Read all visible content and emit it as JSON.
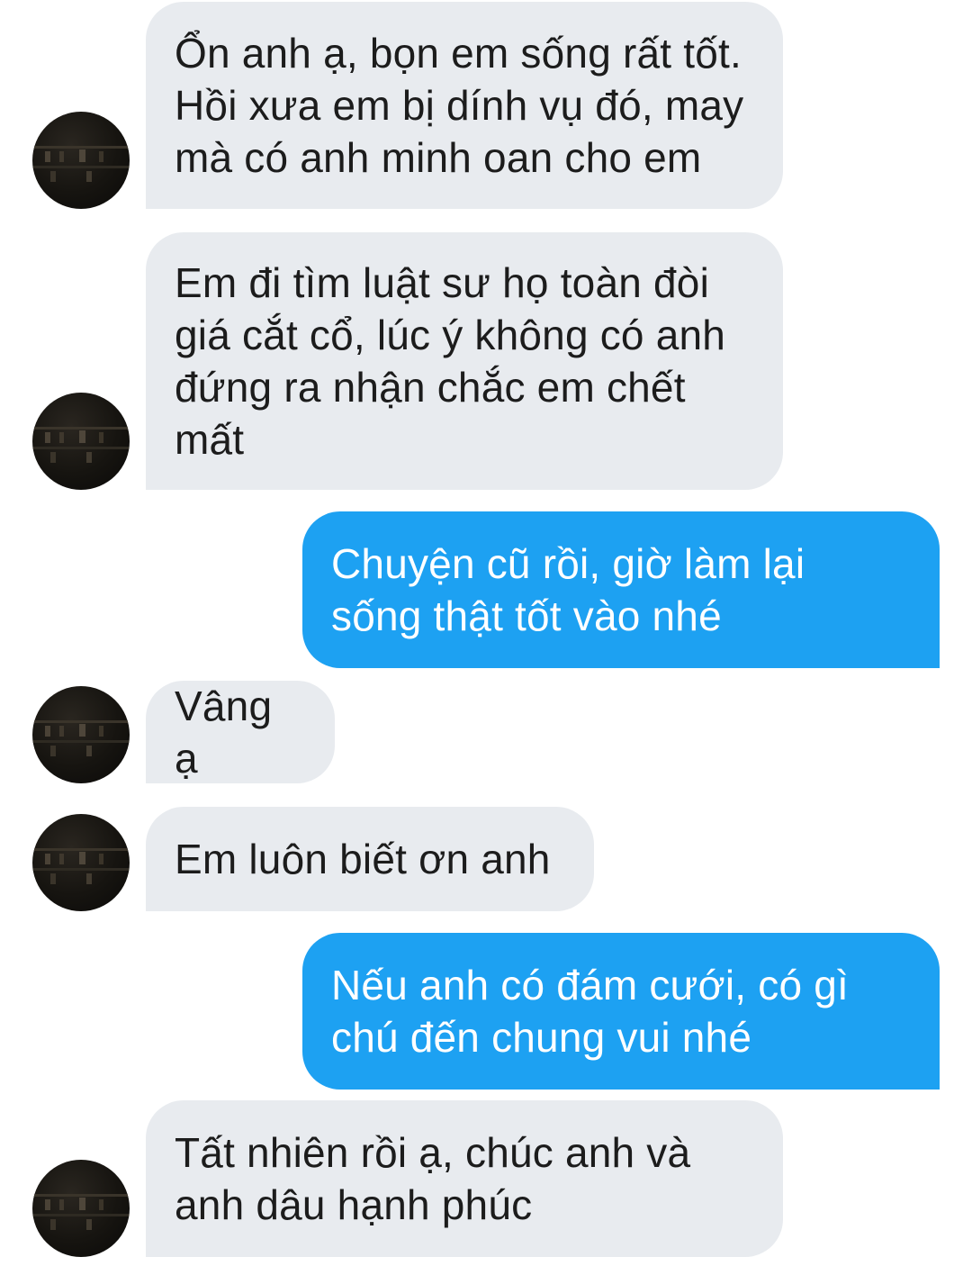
{
  "conversation": {
    "messages": [
      {
        "sender": "contact",
        "text": "Ổn anh ạ, bọn em sống rất tốt.\nHồi xưa em bị dính vụ đó, may\nmà có anh minh oan cho em"
      },
      {
        "sender": "contact",
        "text": "Em đi tìm luật sư họ toàn đòi\ngiá cắt cổ, lúc ý không có anh\nđứng ra nhận chắc em chết\nmất"
      },
      {
        "sender": "me",
        "text": "Chuyện cũ rồi, giờ làm lại\nsống thật tốt vào nhé"
      },
      {
        "sender": "contact",
        "text": "Vâng ạ"
      },
      {
        "sender": "contact",
        "text": "Em luôn biết ơn anh"
      },
      {
        "sender": "me",
        "text": "Nếu anh có đám cưới, có gì\nchú đến chung vui nhé"
      },
      {
        "sender": "contact",
        "text": "Tất nhiên rồi ạ, chúc anh và\nanh dâu hạnh phúc"
      }
    ]
  },
  "colors": {
    "incoming_bubble": "#e8ebef",
    "outgoing_bubble": "#1da1f2",
    "incoming_text": "#1c1c1c",
    "outgoing_text": "#ffffff"
  },
  "icons": {
    "contact_avatar": "contact-avatar-icon"
  }
}
